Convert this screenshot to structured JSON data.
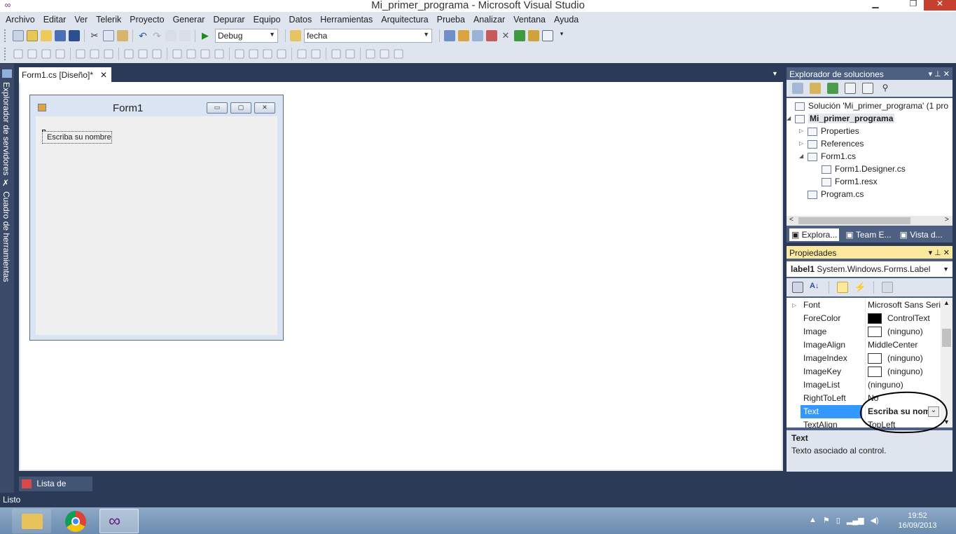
{
  "window": {
    "title": "Mi_primer_programa - Microsoft Visual Studio"
  },
  "menu": [
    "Archivo",
    "Editar",
    "Ver",
    "Telerik",
    "Proyecto",
    "Generar",
    "Depurar",
    "Equipo",
    "Datos",
    "Herramientas",
    "Arquitectura",
    "Prueba",
    "Analizar",
    "Ventana",
    "Ayuda"
  ],
  "toolbar": {
    "config": "Debug",
    "find": "fecha"
  },
  "side_tabs": {
    "servers": "Explorador de servidores",
    "toolbox": "Cuadro de herramientas"
  },
  "doc_tab": {
    "label": "Form1.cs [Diseño]*",
    "close": "✕"
  },
  "designer": {
    "form_title": "Form1",
    "label_text": "Escriba su nombre"
  },
  "solution_explorer": {
    "title": "Explorador de soluciones",
    "items": [
      {
        "label": "Solución 'Mi_primer_programa'  (1 pro",
        "bold": false
      },
      {
        "label": "Mi_primer_programa",
        "bold": true
      },
      {
        "label": "Properties"
      },
      {
        "label": "References"
      },
      {
        "label": "Form1.cs"
      },
      {
        "label": "Form1.Designer.cs"
      },
      {
        "label": "Form1.resx"
      },
      {
        "label": "Program.cs"
      }
    ],
    "tabs": [
      "Explora...",
      "Team E...",
      "Vista d..."
    ]
  },
  "properties": {
    "title": "Propiedades",
    "object": "label1",
    "object_type": "System.Windows.Forms.Label",
    "rows": [
      {
        "name": "Font",
        "value": "Microsoft Sans Seri"
      },
      {
        "name": "ForeColor",
        "value": "ControlText"
      },
      {
        "name": "Image",
        "value": "(ninguno)"
      },
      {
        "name": "ImageAlign",
        "value": "MiddleCenter"
      },
      {
        "name": "ImageIndex",
        "value": "(ninguno)"
      },
      {
        "name": "ImageKey",
        "value": "(ninguno)"
      },
      {
        "name": "ImageList",
        "value": "(ninguno)"
      },
      {
        "name": "RightToLeft",
        "value": "No"
      },
      {
        "name": "Text",
        "value": "Escriba su nom"
      },
      {
        "name": "TextAlign",
        "value": "TopLeft"
      }
    ],
    "desc_title": "Text",
    "desc_text": "Texto asociado al control."
  },
  "bottom": {
    "error_list": "Lista de errores",
    "status": "Listo"
  },
  "taskbar": {
    "time": "19:52",
    "date": "16/09/2013"
  },
  "colors": {
    "accent": "#3399ff",
    "panel_header": "#4d6082",
    "frame": "#2b3a57"
  }
}
